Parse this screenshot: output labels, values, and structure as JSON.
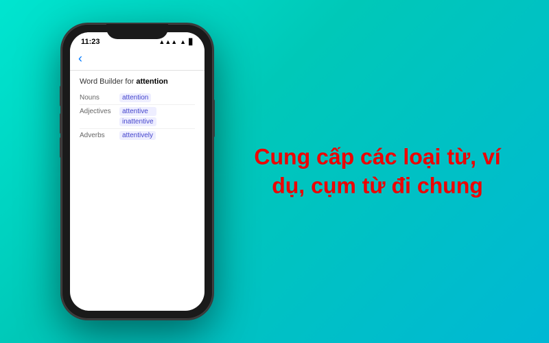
{
  "background": {
    "gradient_start": "#00e5d0",
    "gradient_end": "#00b8d4"
  },
  "phone": {
    "status_bar": {
      "time": "11:23",
      "signal": "▲▲▲",
      "wifi": "▲",
      "battery": "■"
    },
    "nav": {
      "back_icon": "‹",
      "title_prefix": "Word Builder for ",
      "title_word": "attention"
    },
    "word_rows": [
      {
        "type": "Nouns",
        "words": [
          "attention"
        ]
      },
      {
        "type": "Adjectives",
        "words": [
          "attentive",
          "inattentive"
        ]
      },
      {
        "type": "Adverbs",
        "words": [
          "attentively"
        ]
      }
    ]
  },
  "overlay": {
    "text": "Cung cấp các loại từ, ví dụ, cụm từ đi chung"
  }
}
